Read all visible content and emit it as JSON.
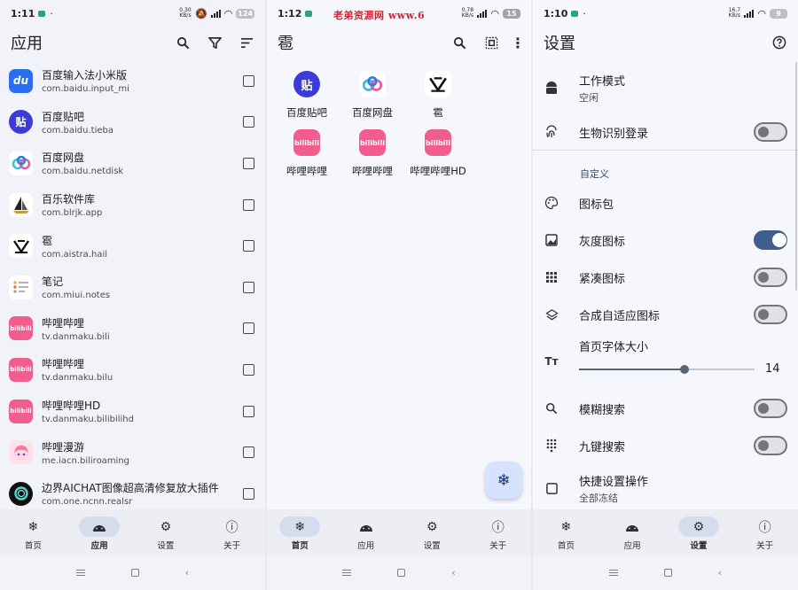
{
  "status_bars": [
    {
      "time": "1:11",
      "speed": "0.30 KB/s",
      "battery": "124"
    },
    {
      "time": "1:12",
      "speed": "0.78 KB/s",
      "battery": "15"
    },
    {
      "time": "1:10",
      "speed": "16.7 KB/s",
      "battery": "9"
    }
  ],
  "watermark": "老弟资源网 www.6",
  "apps_screen": {
    "title": "应用",
    "apps": [
      {
        "name": "百度输入法小米版",
        "package": "com.baidu.input_mi",
        "icon": "du",
        "color": "#2c6ef2"
      },
      {
        "name": "百度贴吧",
        "package": "com.baidu.tieba",
        "icon": "贴",
        "color": "#3d3bd8"
      },
      {
        "name": "百度网盘",
        "package": "com.baidu.netdisk",
        "icon": "cloud-icon",
        "color": "#ffffff"
      },
      {
        "name": "百乐软件库",
        "package": "com.blrjk.app",
        "icon": "sailboat-icon",
        "color": "#ffffff"
      },
      {
        "name": "雹",
        "package": "com.aistra.hail",
        "icon": "hail-icon",
        "color": "#ffffff"
      },
      {
        "name": "笔记",
        "package": "com.miui.notes",
        "icon": "notes-icon",
        "color": "#ffffff"
      },
      {
        "name": "哔哩哔哩",
        "package": "tv.danmaku.bili",
        "icon": "bilibili",
        "color": "#f25d8e"
      },
      {
        "name": "哔哩哔哩",
        "package": "tv.danmaku.bilu",
        "icon": "bilibili",
        "color": "#f25d8e"
      },
      {
        "name": "哔哩哔哩HD",
        "package": "tv.danmaku.bilibilihd",
        "icon": "bilibili",
        "color": "#f25d8e"
      },
      {
        "name": "哔哩漫游",
        "package": "me.iacn.biliroaming",
        "icon": "anime-girl-icon",
        "color": "#ffe1ea"
      },
      {
        "name": "边界AICHAT图像超高清修复放大插件",
        "package": "com.one.ncnn.realsr",
        "icon": "ring-icon",
        "color": "#111111"
      }
    ]
  },
  "frozen_screen": {
    "title": "雹",
    "apps": [
      {
        "name": "百度贴吧",
        "icon": "贴",
        "color": "#3d3bd8"
      },
      {
        "name": "百度网盘",
        "icon": "cloud-icon",
        "color": "#ffffff"
      },
      {
        "name": "雹",
        "icon": "hail-icon",
        "color": "#ffffff"
      },
      {
        "name": "哔哩哔哩",
        "icon": "bilibili",
        "color": "#f25d8e"
      },
      {
        "name": "哔哩哔哩",
        "icon": "bilibili",
        "color": "#f25d8e"
      },
      {
        "name": "哔哩哔哩HD",
        "icon": "bilibili",
        "color": "#f25d8e"
      }
    ],
    "fab_icon": "snowflake-icon"
  },
  "settings_screen": {
    "title": "设置",
    "work_mode": {
      "label": "工作模式",
      "value": "空闲"
    },
    "biometric": {
      "label": "生物识别登录",
      "on": false
    },
    "section": "自定义",
    "icon_pack": {
      "label": "图标包"
    },
    "grayscale": {
      "label": "灰度图标",
      "on": true
    },
    "compact": {
      "label": "紧凑图标",
      "on": false
    },
    "adaptive": {
      "label": "合成自适应图标",
      "on": false
    },
    "font_size": {
      "label": "首页字体大小",
      "value": "14",
      "fraction": 0.6
    },
    "fuzzy": {
      "label": "模糊搜索",
      "on": false
    },
    "t9": {
      "label": "九键搜索",
      "on": false
    },
    "quick": {
      "label": "快捷设置操作",
      "value": "全部冻结"
    }
  },
  "nav": {
    "home": "首页",
    "apps": "应用",
    "settings": "设置",
    "about": "关于"
  },
  "bilibili_text": "bilibili",
  "accent": "#3e5f8e"
}
